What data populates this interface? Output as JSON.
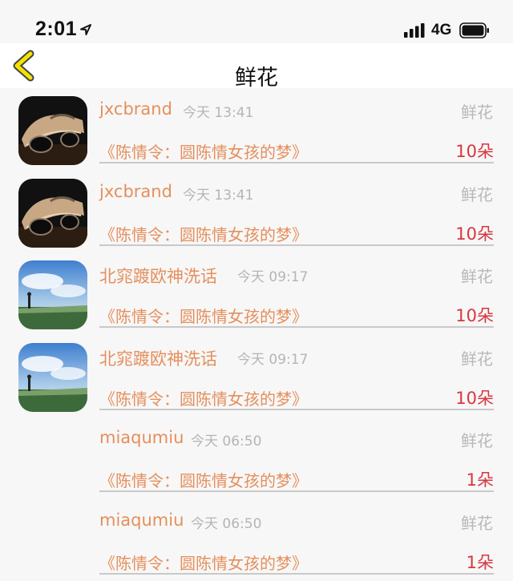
{
  "status": {
    "time": "2:01",
    "network": "4G"
  },
  "nav": {
    "title": "鲜花"
  },
  "records": [
    {
      "user": "jxcbrand",
      "time": "今天 13:41",
      "type": "鲜花",
      "work": "《陈情令：圆陈情女孩的梦》",
      "count": "10朵",
      "avatar": "car"
    },
    {
      "user": "jxcbrand",
      "time": "今天 13:41",
      "type": "鲜花",
      "work": "《陈情令：圆陈情女孩的梦》",
      "count": "10朵",
      "avatar": "car"
    },
    {
      "user": "北窕踱欧神洗话",
      "time": "今天 09:17",
      "type": "鲜花",
      "work": "《陈情令：圆陈情女孩的梦》",
      "count": "10朵",
      "avatar": "sky"
    },
    {
      "user": "北窕踱欧神洗话",
      "time": "今天 09:17",
      "type": "鲜花",
      "work": "《陈情令：圆陈情女孩的梦》",
      "count": "10朵",
      "avatar": "sky"
    },
    {
      "user": "miaqumiu",
      "time": "今天 06:50",
      "type": "鲜花",
      "work": "《陈情令：圆陈情女孩的梦》",
      "count": "1朵",
      "avatar": "none"
    },
    {
      "user": "miaqumiu",
      "time": "今天 06:50",
      "type": "鲜花",
      "work": "《陈情令：圆陈情女孩的梦》",
      "count": "1朵",
      "avatar": "none"
    }
  ]
}
